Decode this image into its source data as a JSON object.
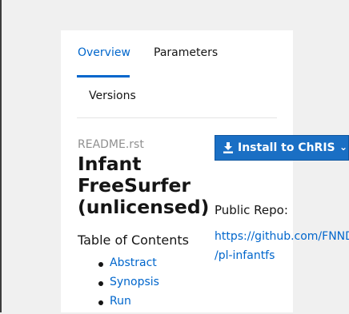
{
  "tabs": {
    "overview": "Overview",
    "parameters": "Parameters",
    "versions": "Versions",
    "active": "Overview"
  },
  "readme": {
    "filename": "README.rst",
    "title_line1": "Infant",
    "title_line2": "FreeSurfer",
    "title_line3": "(unlicensed)",
    "toc_heading": "Table of Contents",
    "toc_items": [
      "Abstract",
      "Synopsis",
      "Run"
    ]
  },
  "install": {
    "label": "Install to ChRIS",
    "icon": "download-icon",
    "dropdown_icon": "chevron-down-icon"
  },
  "repo": {
    "label": "Public Repo:",
    "url_line1": "https://github.com/FNNDSC",
    "url_line2": "/pl-infantfs"
  },
  "colors": {
    "accent": "#0066cc",
    "button": "#1a6fc4",
    "text": "#151515",
    "muted": "#909090",
    "background": "#f0f0f0"
  }
}
